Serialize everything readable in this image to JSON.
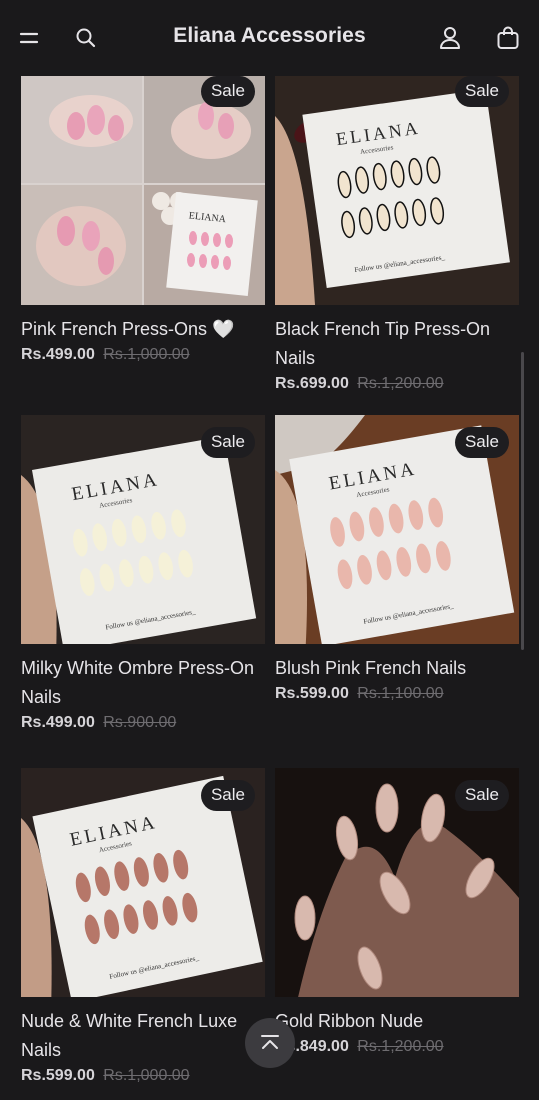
{
  "header": {
    "title": "Eliana Accessories",
    "icons": [
      "menu-icon",
      "search-icon",
      "account-icon",
      "cart-icon"
    ]
  },
  "products": [
    {
      "name": "Pink French Press-Ons 🤍",
      "price": "Rs.499.00",
      "compare_price": "Rs.1,000.00",
      "badge": "Sale"
    },
    {
      "name": "Black French Tip Press-On Nails",
      "price": "Rs.699.00",
      "compare_price": "Rs.1,200.00",
      "badge": "Sale"
    },
    {
      "name": "Milky White Ombre Press-On Nails",
      "price": "Rs.499.00",
      "compare_price": "Rs.900.00",
      "badge": "Sale"
    },
    {
      "name": "Blush Pink French Nails",
      "price": "Rs.599.00",
      "compare_price": "Rs.1,100.00",
      "badge": "Sale"
    },
    {
      "name": "Nude & White French Luxe Nails",
      "price": "Rs.599.00",
      "compare_price": "Rs.1,000.00",
      "badge": "Sale"
    },
    {
      "name": "Gold Ribbon Nude",
      "price": "Rs.849.00",
      "compare_price": "Rs.1,200.00",
      "badge": "Sale"
    }
  ],
  "card_text": {
    "brand": "ELIANA",
    "sub": "Accessories",
    "follow": "Follow us @eliana_accessories_"
  },
  "colors": {
    "background": "#1a191b",
    "badge": "#1e1d20",
    "compare": "#6e6c70"
  }
}
